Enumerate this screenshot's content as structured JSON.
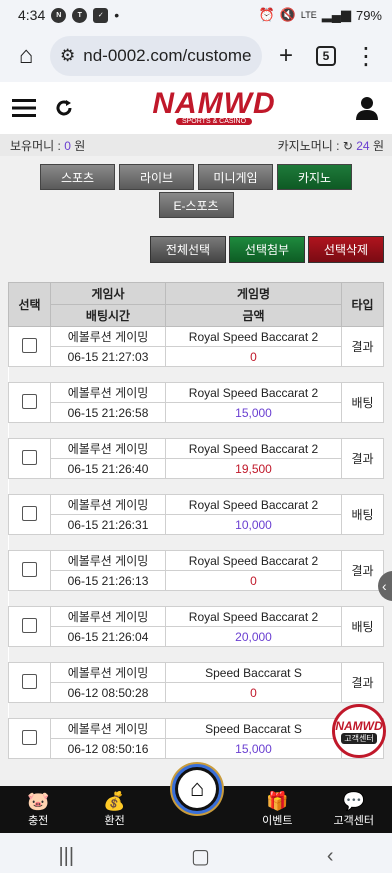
{
  "status": {
    "time": "4:34",
    "battery": "79%",
    "lte": "LTE"
  },
  "browser": {
    "url": "nd-0002.com/custome",
    "tab_count": "5"
  },
  "site": {
    "logo_main": "NAMWD",
    "logo_sub": "SPORTS & CASINO"
  },
  "money": {
    "holding_label": "보유머니 :",
    "holding_value": "0",
    "holding_unit": "원",
    "casino_label": "카지노머니 :",
    "casino_value": "24",
    "casino_unit": "원"
  },
  "categories": [
    "스포츠",
    "라이브",
    "미니게임",
    "카지노",
    "E-스포츠"
  ],
  "actions": {
    "select_all": "전체선택",
    "attach": "선택첨부",
    "delete": "선택삭제"
  },
  "table": {
    "headers": {
      "select": "선택",
      "provider": "게임사",
      "bet_time": "배팅시간",
      "game_name": "게임명",
      "amount": "금액",
      "type": "타입"
    },
    "rows": [
      {
        "provider": "에볼루션 게이밍",
        "time": "06-15 21:27:03",
        "game": "Royal Speed Baccarat 2",
        "amount": "0",
        "type": "결과"
      },
      {
        "provider": "에볼루션 게이밍",
        "time": "06-15 21:26:58",
        "game": "Royal Speed Baccarat 2",
        "amount": "15,000",
        "type": "배팅"
      },
      {
        "provider": "에볼루션 게이밍",
        "time": "06-15 21:26:40",
        "game": "Royal Speed Baccarat 2",
        "amount": "19,500",
        "type": "결과"
      },
      {
        "provider": "에볼루션 게이밍",
        "time": "06-15 21:26:31",
        "game": "Royal Speed Baccarat 2",
        "amount": "10,000",
        "type": "배팅"
      },
      {
        "provider": "에볼루션 게이밍",
        "time": "06-15 21:26:13",
        "game": "Royal Speed Baccarat 2",
        "amount": "0",
        "type": "결과"
      },
      {
        "provider": "에볼루션 게이밍",
        "time": "06-15 21:26:04",
        "game": "Royal Speed Baccarat 2",
        "amount": "20,000",
        "type": "배팅"
      },
      {
        "provider": "에볼루션 게이밍",
        "time": "06-12 08:50:28",
        "game": "Speed Baccarat S",
        "amount": "0",
        "type": "결과"
      },
      {
        "provider": "에볼루션 게이밍",
        "time": "06-12 08:50:16",
        "game": "Speed Baccarat S",
        "amount": "15,000",
        "type": ""
      }
    ]
  },
  "service_badge": {
    "line1": "NAMWD",
    "line2": "고객센터"
  },
  "bottom_nav": {
    "deposit": "충전",
    "withdraw": "환전",
    "event": "이벤트",
    "support": "고객센터"
  },
  "colors": {
    "brand_red": "#c0182a",
    "purple": "#6a3fd1",
    "casino_green": "#1e7a3a"
  }
}
